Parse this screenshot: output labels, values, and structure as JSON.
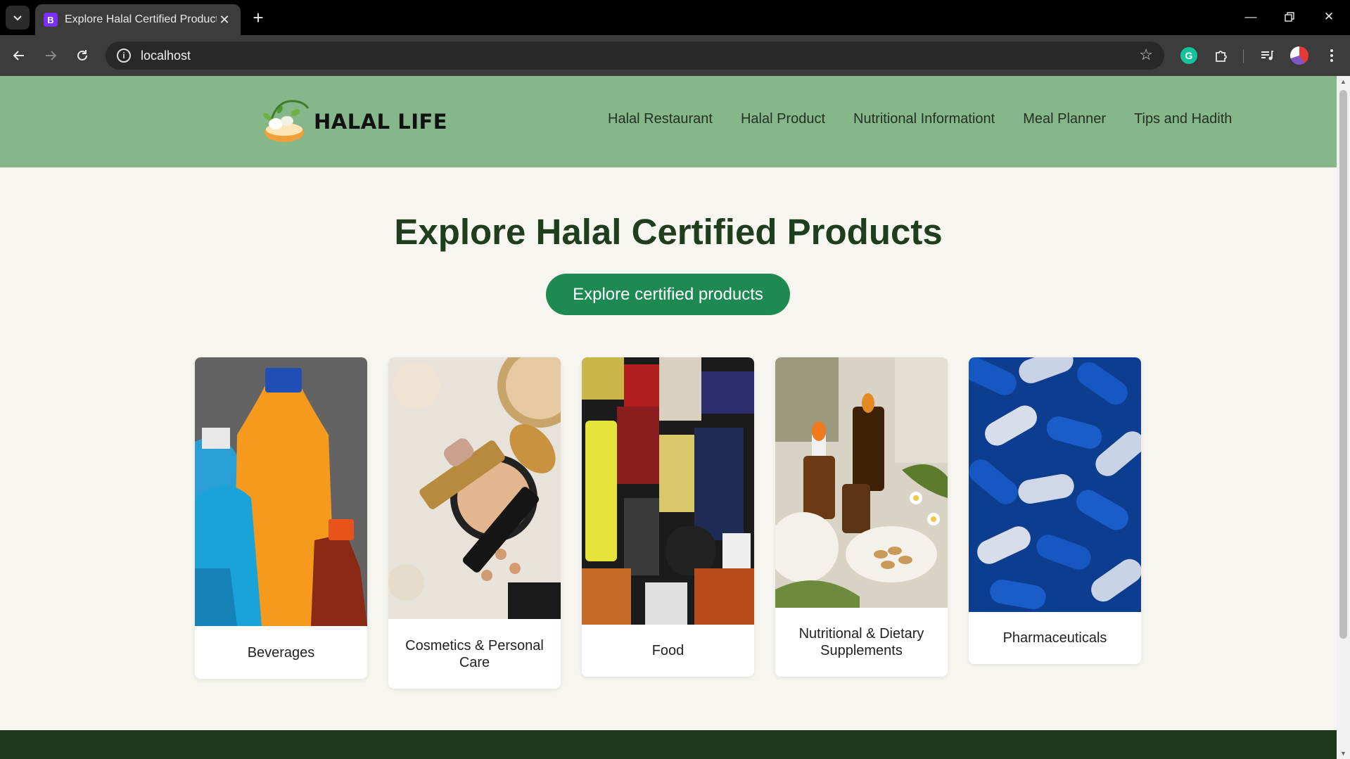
{
  "browser": {
    "tab_title": "Explore Halal Certified Products",
    "favicon_letter": "B",
    "url": "localhost"
  },
  "site": {
    "logo_text": "HALAL LIFE",
    "nav": [
      "Halal Restaurant",
      "Halal Product",
      "Nutritional Informationt",
      "Meal Planner",
      "Tips and Hadith"
    ]
  },
  "hero": {
    "title": "Explore Halal Certified Products",
    "cta_label": "Explore certified products"
  },
  "categories": [
    {
      "label": "Beverages",
      "image": "beverage-bottles"
    },
    {
      "label": "Cosmetics & Personal Care",
      "image": "cosmetics-makeup"
    },
    {
      "label": "Food",
      "image": "packaged-food"
    },
    {
      "label": "Nutritional & Dietary Supplements",
      "image": "supplement-bottles"
    },
    {
      "label": "Pharmaceuticals",
      "image": "blue-capsules"
    }
  ],
  "colors": {
    "header_bg": "#86b78a",
    "cta_bg": "#1d8a52",
    "title_color": "#1f3d1f",
    "footer_bg": "#1e3a1e"
  }
}
